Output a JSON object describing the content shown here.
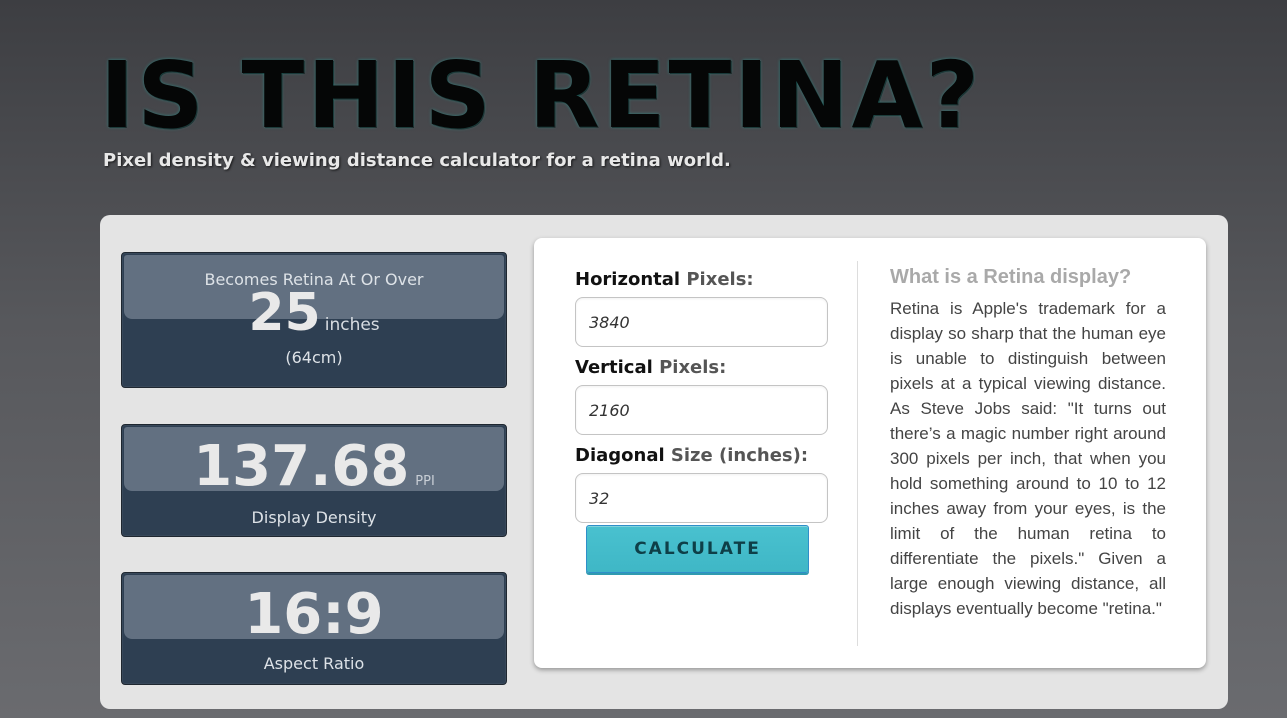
{
  "header": {
    "title": "IS THIS RETINA?",
    "tagline": "Pixel density & viewing distance calculator for a retina world."
  },
  "results": {
    "retina": {
      "heading": "Becomes Retina At Or Over",
      "value": "25",
      "unit": "inches",
      "metric": "(64cm)"
    },
    "density": {
      "value": "137.68",
      "unit": "PPI",
      "caption": "Display Density"
    },
    "aspect": {
      "value": "16:9",
      "caption": "Aspect Ratio"
    }
  },
  "form": {
    "horizontal": {
      "label_dark": "Horizontal",
      "label_grey": "Pixels:",
      "value": "3840"
    },
    "vertical": {
      "label_dark": "Vertical",
      "label_grey": "Pixels:",
      "value": "2160"
    },
    "diagonal": {
      "label_dark": "Diagonal",
      "label_grey": "Size (inches):",
      "value": "32"
    },
    "calculate_label": "CALCULATE"
  },
  "info": {
    "title": "What is a Retina display?",
    "text": "Retina is Apple's trademark for a display so sharp that the human eye is unable to distinguish between pixels at a typical viewing distance. As Steve Jobs said: \"It turns out there’s a magic number right around 300 pixels per inch, that when you hold something around to 10 to 12 inches away from your eyes, is the limit of the human retina to differentiate the pixels.\" Given a large enough viewing distance, all displays eventually become \"retina.\""
  },
  "colors": {
    "accent": "#43bccb",
    "card_bg": "#2e3f52",
    "panel_bg": "#e4e4e4"
  }
}
